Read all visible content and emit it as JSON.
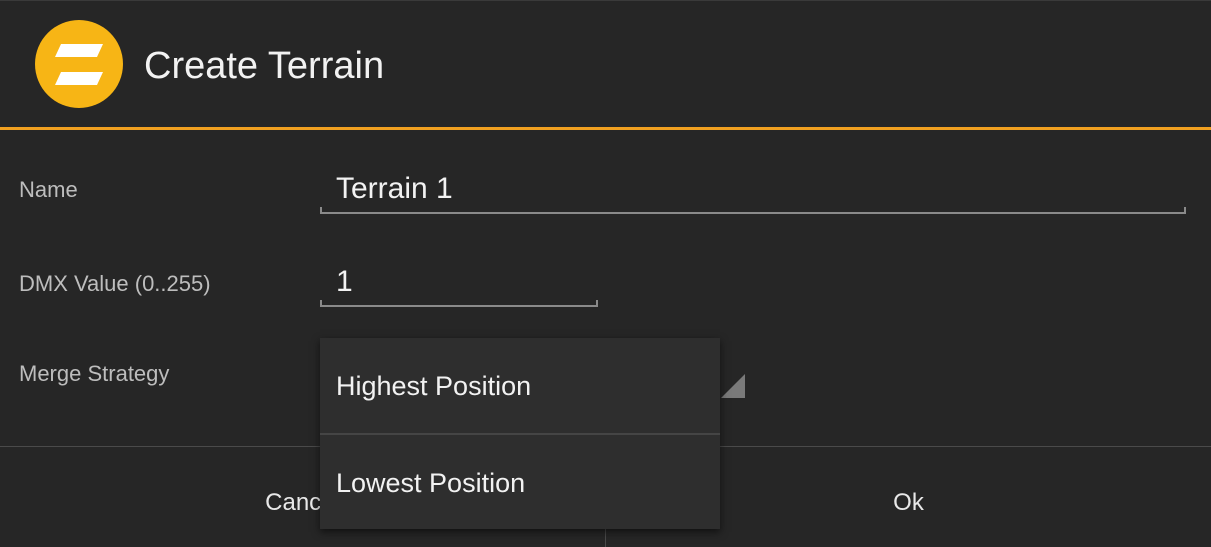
{
  "dialog": {
    "title": "Create Terrain",
    "logo_icon": "app-logo-icon",
    "accent_color": "#f0a020"
  },
  "form": {
    "name_label": "Name",
    "name_value": "Terrain 1",
    "dmx_label": "DMX Value (0..255)",
    "dmx_value": "1",
    "merge_label": "Merge Strategy",
    "merge_options": [
      "Highest Position",
      "Lowest Position"
    ]
  },
  "buttons": {
    "cancel_label": "Cancel",
    "ok_label": "Ok"
  }
}
